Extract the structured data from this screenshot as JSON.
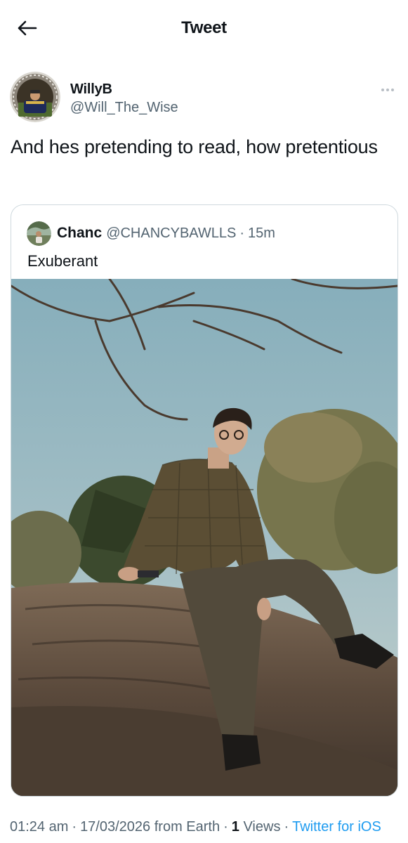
{
  "header": {
    "title": "Tweet",
    "back_icon": "arrow-left-icon"
  },
  "tweet": {
    "author": {
      "display_name": "WillyB",
      "handle": "@Will_The_Wise"
    },
    "more_icon": "more-horizontal-icon",
    "text": "And hes pretending to read, how pretentious",
    "quoted": {
      "author": {
        "display_name": "Chanc",
        "handle": "@CHANCYBAWLLS"
      },
      "separator": "·",
      "time": "15m",
      "text": "Exuberant"
    },
    "meta": {
      "time": "01:24 am",
      "date": "17/03/2026",
      "location": "from Earth",
      "views_count": "1",
      "views_label": "Views",
      "source": "Twitter for iOS",
      "separator": "·"
    }
  },
  "colors": {
    "text": "#0f1419",
    "secondary": "#536471",
    "link": "#1d9bf0",
    "border": "#cfd9de"
  }
}
